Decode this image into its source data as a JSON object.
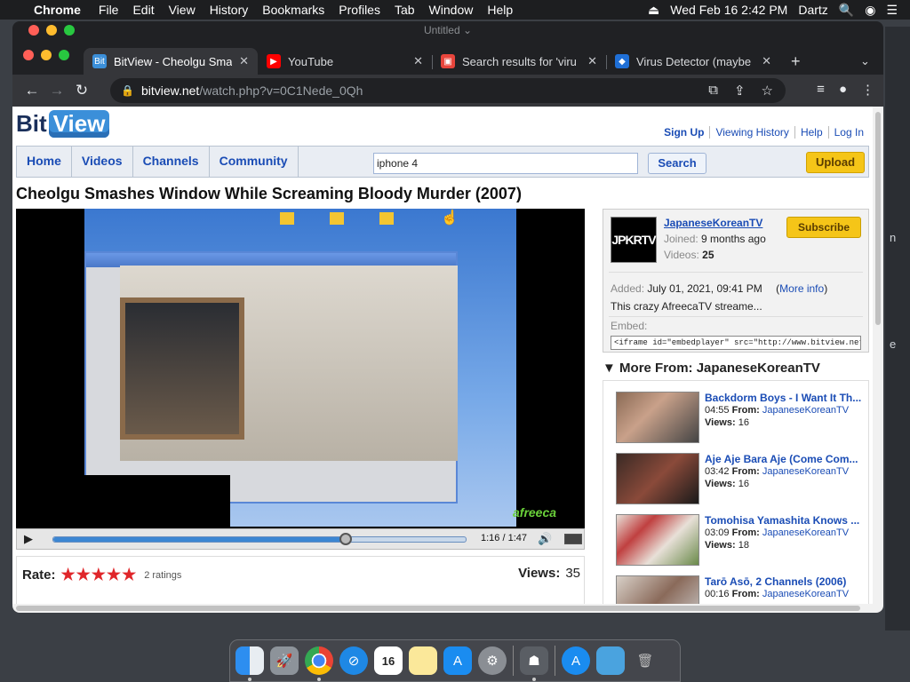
{
  "menubar": {
    "app": "Chrome",
    "items": [
      "File",
      "Edit",
      "View",
      "History",
      "Bookmarks",
      "Profiles",
      "Tab",
      "Window",
      "Help"
    ],
    "datetime": "Wed Feb 16  2:42 PM",
    "user": "Dartz"
  },
  "window": {
    "title": "Untitled"
  },
  "tabs": [
    {
      "title": "BitView - Cheolgu Sma",
      "fav": "Bit"
    },
    {
      "title": "YouTube"
    },
    {
      "title": "Search results for 'viru"
    },
    {
      "title": "Virus Detector (maybe"
    }
  ],
  "address": {
    "host": "bitview.net",
    "path": "/watch.php?v=0C1Nede_0Qh"
  },
  "site": {
    "logo_a": "Bit",
    "logo_b": "View",
    "toplinks": [
      "Sign Up",
      "Viewing History",
      "Help",
      "Log In"
    ],
    "nav": [
      "Home",
      "Videos",
      "Channels",
      "Community"
    ],
    "search_value": "iphone 4",
    "search_button": "Search",
    "upload": "Upload"
  },
  "video": {
    "title": "Cheolgu Smashes Window While Screaming Bloody Murder (2007)",
    "time": "1:16 / 1:47",
    "progress": 0.71,
    "watermark": "afreeca",
    "rate_label": "Rate:",
    "stars": "★★★★★",
    "ratings": "2 ratings",
    "views_label": "Views:",
    "views": "35"
  },
  "channel": {
    "avatar": "JPKRTV",
    "name": "JapaneseKoreanTV",
    "joined_label": "Joined:",
    "joined": "9 months ago",
    "videos_label": "Videos:",
    "videos": "25",
    "subscribe": "Subscribe",
    "added_label": "Added:",
    "added": "July 01, 2021, 09:41 PM",
    "more_info": "More info",
    "description": "This crazy AfreecaTV streame...",
    "embed_label": "Embed:",
    "embed_code": "<iframe id=\"embedplayer\" src=\"http://www.bitview.net/embed.p"
  },
  "more_from": {
    "header": "More From: JapaneseKoreanTV",
    "from_label": "From:",
    "views_label": "Views:",
    "items": [
      {
        "title": "Backdorm Boys - I Want It Th...",
        "duration": "04:55",
        "channel": "JapaneseKoreanTV",
        "views": "16"
      },
      {
        "title": "Aje Aje Bara Aje (Come Com...",
        "duration": "03:42",
        "channel": "JapaneseKoreanTV",
        "views": "16"
      },
      {
        "title": "Tomohisa Yamashita Knows ...",
        "duration": "03:09",
        "channel": "JapaneseKoreanTV",
        "views": "18"
      },
      {
        "title": "Tarō Asō, 2 Channels (2006)",
        "duration": "00:16",
        "channel": "JapaneseKoreanTV",
        "views": ""
      }
    ]
  },
  "dock": {
    "calendar_day": "16"
  },
  "colors": {
    "link": "#1a4cb5",
    "upload": "#f5c518",
    "progress": "#3c86d2"
  }
}
